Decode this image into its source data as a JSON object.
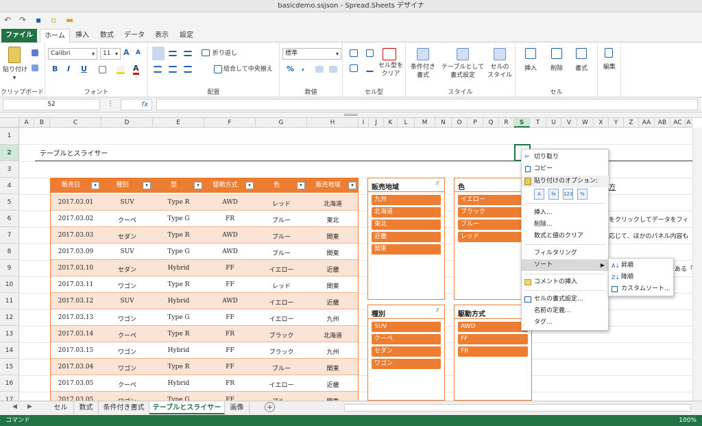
{
  "window": {
    "title": "basicdemo.ssjson - Spread.Sheets デザイナ"
  },
  "ribbon_tabs": [
    {
      "label": "ファイル"
    },
    {
      "label": "ホーム"
    },
    {
      "label": "挿入"
    },
    {
      "label": "数式"
    },
    {
      "label": "データ"
    },
    {
      "label": "表示"
    },
    {
      "label": "設定"
    }
  ],
  "ribbon": {
    "clipboard": {
      "group": "クリップボード",
      "paste": "貼り付け"
    },
    "font": {
      "group": "フォント",
      "name": "Calibri",
      "size": "11",
      "bold": "B",
      "italic": "I",
      "underline": "U"
    },
    "alignment": {
      "group": "配置",
      "wrap": "折り返し",
      "merge": "結合して中央揃え"
    },
    "number": {
      "group": "数値",
      "format": "標準",
      "percent": "%",
      "comma": ","
    },
    "celltype": {
      "group": "セル型",
      "clear": "セル型を\nクリア"
    },
    "style": {
      "group": "スタイル",
      "conditional": "条件付き\n書式",
      "as_table": "テーブルとして\n書式設定",
      "cell_style": "セルの\nスタイル"
    },
    "cells": {
      "group": "セル",
      "insert": "挿入",
      "delete": "削除",
      "format": "書式"
    },
    "edit": {
      "label": "編集"
    }
  },
  "formula_bar": {
    "name_box": "S2",
    "fx": "fx",
    "formula": ""
  },
  "columns": [
    "A",
    "B",
    "C",
    "D",
    "E",
    "F",
    "G",
    "H",
    "I",
    "J",
    "K",
    "L",
    "M",
    "N",
    "O",
    "P",
    "Q",
    "R",
    "S",
    "T",
    "U",
    "V",
    "W",
    "X",
    "Y",
    "Z",
    "AA",
    "AB",
    "AC",
    "A"
  ],
  "rows": [
    "1",
    "2",
    "3",
    "4",
    "5",
    "6",
    "7",
    "8",
    "9",
    "10",
    "11",
    "12",
    "13",
    "14",
    "15",
    "16",
    "17"
  ],
  "sheet_title": "テーブルとスライサー",
  "table": {
    "headers": [
      "販売日",
      "種別",
      "型",
      "駆動方式",
      "色",
      "販売地域"
    ],
    "rows": [
      [
        "2017.03.01",
        "SUV",
        "Type R",
        "AWD",
        "レッド",
        "北海道"
      ],
      [
        "2017.03.02",
        "クーペ",
        "Type G",
        "FR",
        "ブルー",
        "東北"
      ],
      [
        "2017.03.03",
        "セダン",
        "Type R",
        "AWD",
        "ブルー",
        "関東"
      ],
      [
        "2017.03.09",
        "SUV",
        "Type G",
        "AWD",
        "ブルー",
        "関東"
      ],
      [
        "2017.03.10",
        "セダン",
        "Hybrid",
        "FF",
        "イエロー",
        "近畿"
      ],
      [
        "2017.03.11",
        "ワゴン",
        "Type R",
        "FF",
        "レッド",
        "関東"
      ],
      [
        "2017.03.12",
        "SUV",
        "Hybrid",
        "AWD",
        "イエロー",
        "近畿"
      ],
      [
        "2017.03.13",
        "ワゴン",
        "Type G",
        "FF",
        "イエロー",
        "九州"
      ],
      [
        "2017.03.14",
        "クーペ",
        "Type R",
        "FR",
        "ブラック",
        "北海道"
      ],
      [
        "2017.03.15",
        "ワゴン",
        "Hybrid",
        "FF",
        "ブラック",
        "九州"
      ],
      [
        "2017.03.04",
        "ワゴン",
        "Type R",
        "FF",
        "ブルー",
        "関東"
      ],
      [
        "2017.03.05",
        "クーペ",
        "Hybrid",
        "FR",
        "イエロー",
        "近畿"
      ],
      [
        "2017.03.05",
        "ワゴン",
        "Type G",
        "FF",
        "ブルー",
        "関東"
      ]
    ]
  },
  "slicers": [
    {
      "title": "販売地域",
      "clear": "✗",
      "items": [
        "九州",
        "北海道",
        "東北",
        "近畿",
        "関東"
      ]
    },
    {
      "title": "色",
      "items": [
        "イエロー",
        "ブラック",
        "ブルー",
        "レッド"
      ]
    },
    {
      "title": "種別",
      "clear": "✗",
      "items": [
        "SUV",
        "クーペ",
        "セダン",
        "ワゴン"
      ]
    },
    {
      "title": "駆動方式",
      "items": [
        "AWD",
        "FF",
        "FR"
      ]
    }
  ],
  "side_text": {
    "heading": "方",
    "line1": "をクリックしてデータをフィ",
    "line2": "応じて、ほかのパネル内容も",
    "line3": "ある「"
  },
  "context_menu": {
    "cut": "切り取り",
    "copy": "コピー",
    "paste_options": "貼り付けのオプション:",
    "paste_icons": [
      "A",
      "fx",
      "123",
      "%"
    ],
    "insert": "挿入...",
    "delete": "削除...",
    "clear": "数式と値のクリア",
    "filter": "フィルタリング",
    "sort": "ソート",
    "insert_comment": "コメントの挿入",
    "format_cells": "セルの書式設定...",
    "define_name": "名前の定義...",
    "tag": "タグ..."
  },
  "sort_submenu": {
    "asc": "昇順",
    "desc": "降順",
    "custom": "カスタムソート..."
  },
  "sheet_tabs": [
    {
      "label": "セル"
    },
    {
      "label": "数式"
    },
    {
      "label": "条件付き書式"
    },
    {
      "label": "テーブルとスライサー"
    },
    {
      "label": "画像"
    }
  ],
  "status": {
    "mode": "コマンド",
    "zoom": "100%"
  }
}
